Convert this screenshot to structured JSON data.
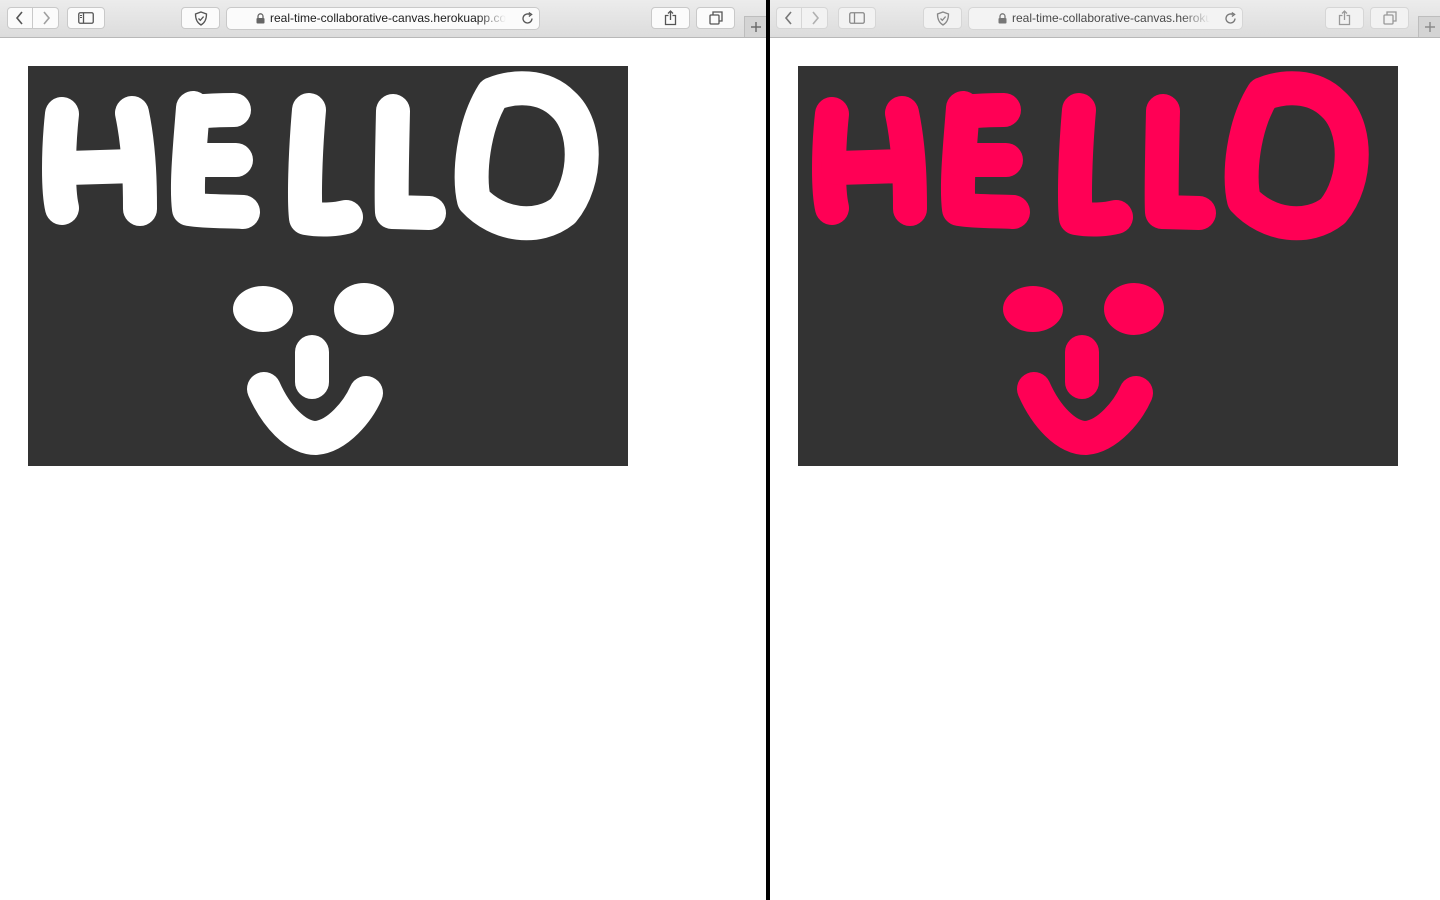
{
  "left_window": {
    "url": "real-time-collaborative-canvas.herokuapp.com",
    "canvas": {
      "background": "#333333",
      "stroke_color": "#ffffff"
    }
  },
  "right_window": {
    "url": "real-time-collaborative-canvas.herokuapp.com",
    "canvas": {
      "background": "#333333",
      "stroke_color": "#ff0055"
    }
  },
  "icons": {
    "back": "chevron-left-icon",
    "forward": "chevron-right-icon",
    "sidebar": "sidebar-icon",
    "privacy": "shield-icon",
    "lock": "lock-icon",
    "reload": "reload-icon",
    "share": "share-icon",
    "tabs": "tabs-overview-icon",
    "new_tab": "plus-icon"
  }
}
